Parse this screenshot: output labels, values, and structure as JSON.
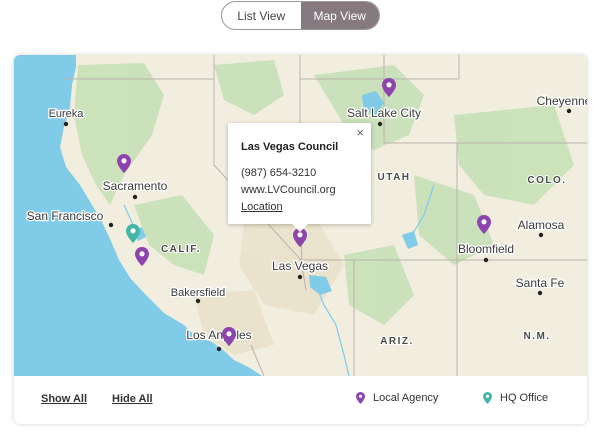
{
  "view_toggle": {
    "list_label": "List View",
    "map_label": "Map View",
    "active": "map"
  },
  "colors": {
    "local_agency": "#8e44ad",
    "hq_office": "#45b5a5",
    "toggle_active": "#86797f",
    "water": "#7fcbe8",
    "land": "#f1eedf"
  },
  "map": {
    "cities": [
      {
        "name": "Eureka"
      },
      {
        "name": "Salt Lake City"
      },
      {
        "name": "Cheyenne"
      },
      {
        "name": "Sacramento"
      },
      {
        "name": "San Francisco"
      },
      {
        "name": "Las Vegas"
      },
      {
        "name": "Alamosa"
      },
      {
        "name": "Bloomfield"
      },
      {
        "name": "Santa Fe"
      },
      {
        "name": "Bakersfield"
      },
      {
        "name": "Los Angeles"
      }
    ],
    "states": [
      "UTAH",
      "COLO.",
      "CALIF.",
      "ARIZ.",
      "N.M."
    ],
    "markers": [
      {
        "type": "local_agency",
        "icon": "map-pin-icon"
      },
      {
        "type": "local_agency",
        "icon": "map-pin-icon"
      },
      {
        "type": "local_agency",
        "icon": "map-pin-icon"
      },
      {
        "type": "local_agency",
        "icon": "map-pin-icon"
      },
      {
        "type": "local_agency",
        "icon": "map-pin-icon"
      },
      {
        "type": "local_agency",
        "icon": "map-pin-icon"
      },
      {
        "type": "hq_office",
        "icon": "map-pin-icon"
      }
    ]
  },
  "popup": {
    "title": "Las Vegas Council",
    "phone": "(987) 654-3210",
    "website": "www.LVCouncil.org",
    "location_link": "Location",
    "close_symbol": "×"
  },
  "footer": {
    "show_all": "Show All",
    "hide_all": "Hide All",
    "legend": [
      {
        "label": "Local Agency",
        "icon": "map-pin-icon",
        "type": "local_agency"
      },
      {
        "label": "HQ Office",
        "icon": "map-pin-icon",
        "type": "hq_office"
      }
    ]
  }
}
